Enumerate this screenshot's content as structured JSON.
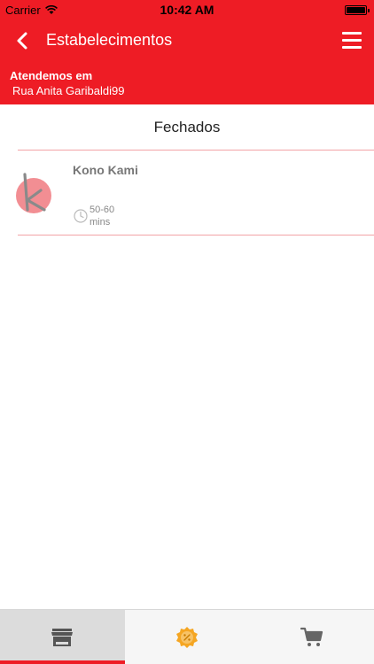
{
  "status_bar": {
    "carrier": "Carrier",
    "time": "10:42 AM"
  },
  "nav": {
    "title": "Estabelecimentos"
  },
  "address": {
    "label": "Atendemos em",
    "value": "Rua Anita Garibaldi99"
  },
  "section": {
    "title": "Fechados"
  },
  "stores": [
    {
      "name": "Kono Kami",
      "delivery_time": "50-60",
      "delivery_unit": "mins"
    }
  ],
  "tabs": [
    {
      "icon": "store-icon",
      "active": true
    },
    {
      "icon": "promotion-badge-icon",
      "active": false
    },
    {
      "icon": "cart-icon",
      "active": false
    }
  ],
  "colors": {
    "brand": "#ee1c25",
    "divider": "#f2a3a6",
    "logo_circle": "#f07a80"
  }
}
